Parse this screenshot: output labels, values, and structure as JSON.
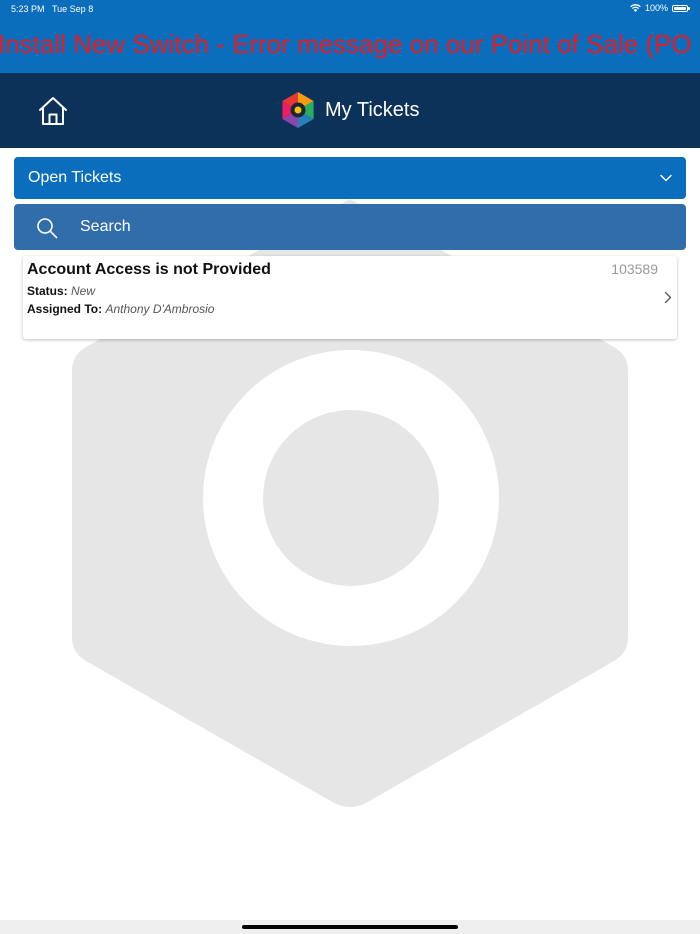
{
  "status_bar": {
    "time": "5:23 PM",
    "date": "Tue Sep 8",
    "battery_pct": "100%",
    "wifi_icon": "wifi-icon",
    "battery_icon": "battery-icon"
  },
  "banner": {
    "text": "Install New Switch  - Error message on our Point of Sale (PO",
    "color": "#e31b23"
  },
  "nav": {
    "home_icon": "home-icon",
    "logo_icon": "app-logo-icon",
    "title": "My Tickets"
  },
  "filter": {
    "selected": "Open Tickets",
    "chevron_icon": "chevron-down-icon"
  },
  "search": {
    "placeholder": "Search",
    "value": "",
    "icon": "search-icon"
  },
  "tickets": [
    {
      "subject": "Account Access is not Provided",
      "id": "103589",
      "status_label": "Status:",
      "status_value": "New",
      "assigned_label": "Assigned To:",
      "assigned_value": "Anthony D'Ambrosio"
    }
  ],
  "colors": {
    "status_bar": "#0a6ebd",
    "nav_bar": "#0c3259",
    "dropdown": "#0a6ebd",
    "search_bar": "#326dab"
  }
}
